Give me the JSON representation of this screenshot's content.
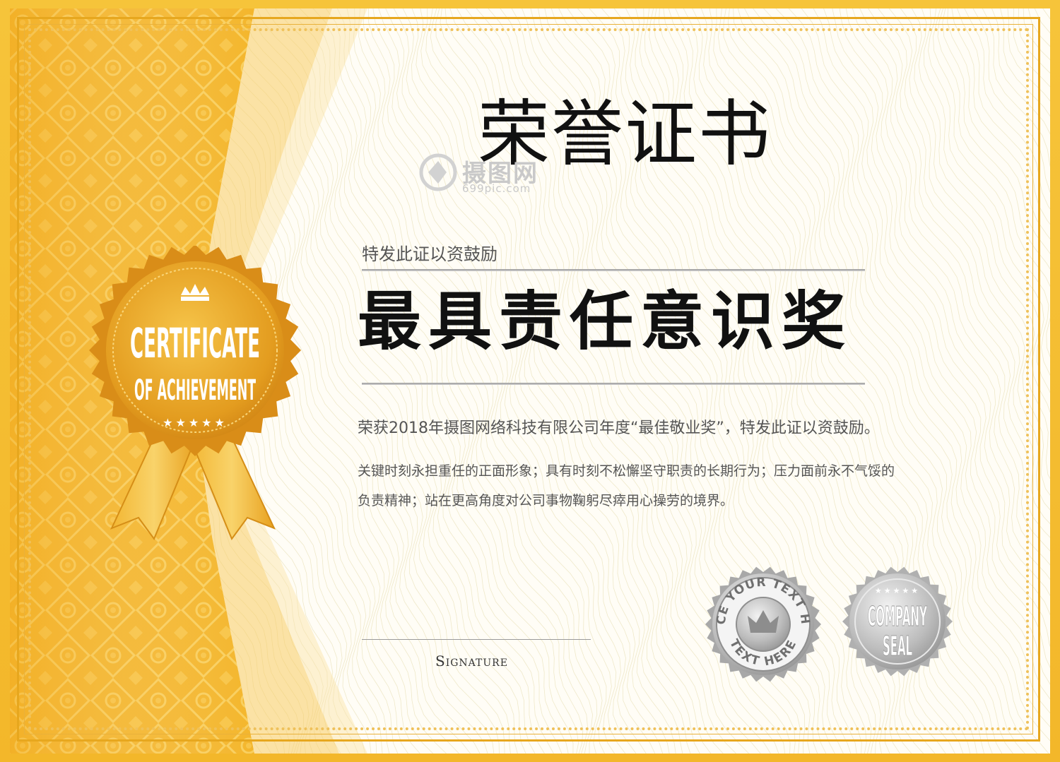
{
  "certificate": {
    "title": "荣誉证书",
    "subtitle": "特发此证以资鼓励",
    "award_name": "最具责任意识奖",
    "description_line1": "荣获2018年摄图网络科技有限公司年度“最佳敬业奖”，特发此证以资鼓励。",
    "description_line2": "关键时刻永担重任的正面形象；具有时刻不松懈坚守职责的长期行为；压力面前永不气馁的",
    "description_line3": "负责精神；站在更高角度对公司事物鞠躬尽瘁用心操劳的境界。",
    "signature_label": "Signature"
  },
  "seal": {
    "line1": "CERTIFICATE",
    "line2": "OF ACHIEVEMENT",
    "stars": "★★★★★"
  },
  "watermark": {
    "name": "摄图网",
    "url": "699pic.com"
  },
  "stamps": {
    "stamp1_ring_top": "PLACE YOUR TEXT HERE",
    "stamp1_ring_bottom": "TEXT HERE",
    "stamp2_line1": "COMPANY",
    "stamp2_line2": "SEAL",
    "stamp2_stars": "★★★★★"
  },
  "colors": {
    "gold": "#f3b72a",
    "gold_dark": "#d9921a",
    "silver": "#b5b5b5",
    "text_dark": "#111111",
    "text_gray": "#555555"
  }
}
